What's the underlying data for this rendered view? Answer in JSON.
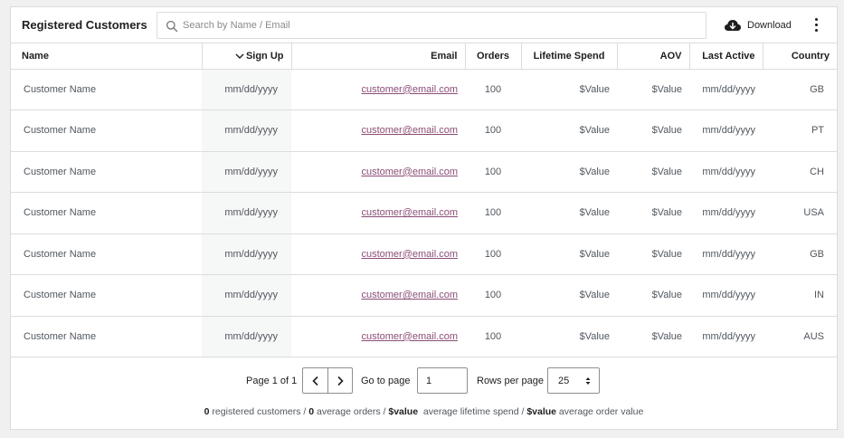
{
  "header": {
    "title": "Registered Customers",
    "search_placeholder": "Search by Name / Email",
    "download_label": "Download",
    "search_icon": "search-icon",
    "download_icon": "cloud-download-icon",
    "more_icon": "vertical-ellipsis-icon"
  },
  "columns": [
    "Name",
    "Sign Up",
    "Email",
    "Orders",
    "Lifetime Spend",
    "AOV",
    "Last Active",
    "Country"
  ],
  "sorted_column": "Sign Up",
  "rows": [
    {
      "name": "Customer Name",
      "signup": "mm/dd/yyyy",
      "email": "customer@email.com",
      "orders": "100",
      "spend": "$Value",
      "aov": "$Value",
      "active": "mm/dd/yyyy",
      "country": "GB"
    },
    {
      "name": "Customer Name",
      "signup": "mm/dd/yyyy",
      "email": "customer@email.com",
      "orders": "100",
      "spend": "$Value",
      "aov": "$Value",
      "active": "mm/dd/yyyy",
      "country": "PT"
    },
    {
      "name": "Customer Name",
      "signup": "mm/dd/yyyy",
      "email": "customer@email.com",
      "orders": "100",
      "spend": "$Value",
      "aov": "$Value",
      "active": "mm/dd/yyyy",
      "country": "CH"
    },
    {
      "name": "Customer Name",
      "signup": "mm/dd/yyyy",
      "email": "customer@email.com",
      "orders": "100",
      "spend": "$Value",
      "aov": "$Value",
      "active": "mm/dd/yyyy",
      "country": "USA"
    },
    {
      "name": "Customer Name",
      "signup": "mm/dd/yyyy",
      "email": "customer@email.com",
      "orders": "100",
      "spend": "$Value",
      "aov": "$Value",
      "active": "mm/dd/yyyy",
      "country": "GB"
    },
    {
      "name": "Customer Name",
      "signup": "mm/dd/yyyy",
      "email": "customer@email.com",
      "orders": "100",
      "spend": "$Value",
      "aov": "$Value",
      "active": "mm/dd/yyyy",
      "country": "IN"
    },
    {
      "name": "Customer Name",
      "signup": "mm/dd/yyyy",
      "email": "customer@email.com",
      "orders": "100",
      "spend": "$Value",
      "aov": "$Value",
      "active": "mm/dd/yyyy",
      "country": "AUS"
    }
  ],
  "pagination": {
    "page_label": "Page 1 of 1",
    "goto_label": "Go to page",
    "goto_value": "1",
    "rows_label": "Rows per page",
    "rows_value": "25"
  },
  "summary": {
    "customers_count": "0",
    "customers_text": " registered customers / ",
    "orders_count": "0",
    "orders_text": " average orders / ",
    "lifetime_value": "$value",
    "lifetime_text": "  average lifetime spend / ",
    "order_value": "$value",
    "order_text": " average order value"
  },
  "colors": {
    "email_link": "#8a4d76",
    "border": "#dcdcde",
    "sorted_column_bg": "#f6f7f7"
  }
}
